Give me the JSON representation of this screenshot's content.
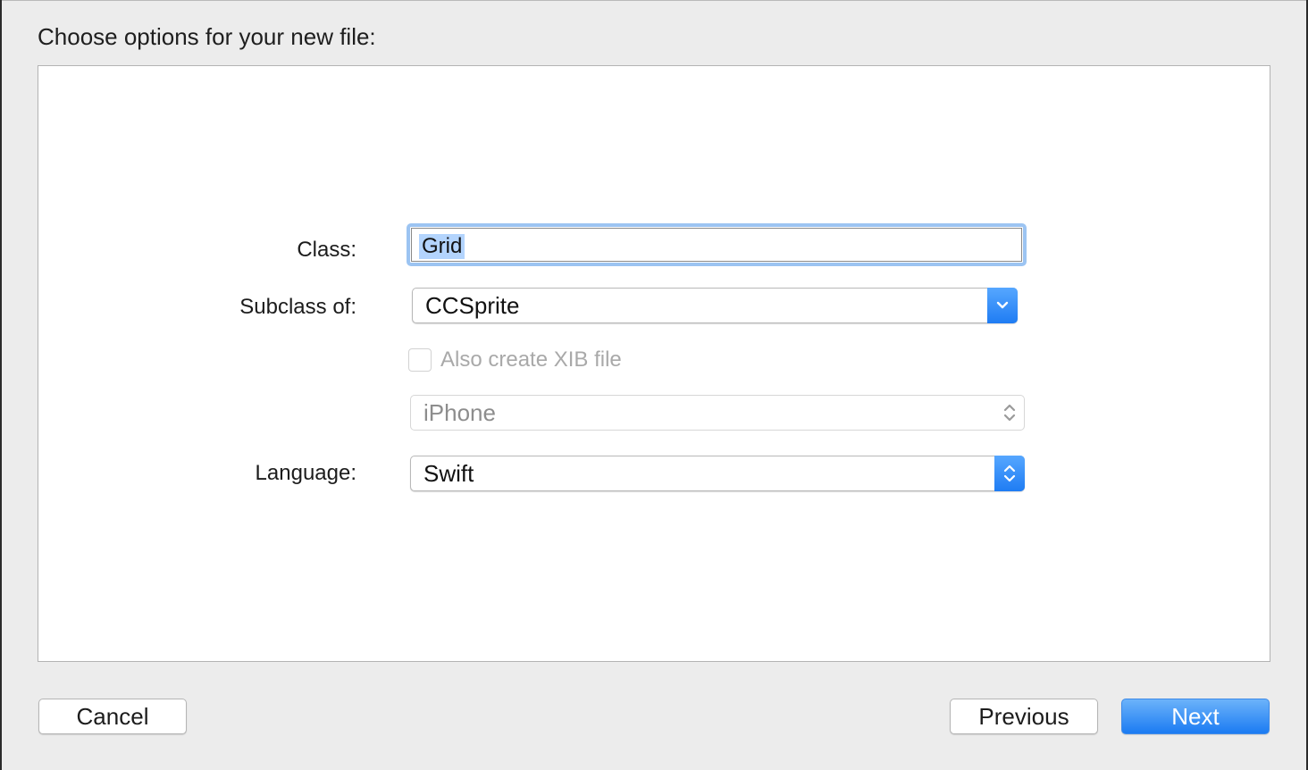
{
  "sheet": {
    "title": "Choose options for your new file:"
  },
  "form": {
    "class_label": "Class:",
    "class_value": "Grid",
    "subclass_label": "Subclass of:",
    "subclass_value": "CCSprite",
    "xib_checkbox_label": "Also create XIB file",
    "xib_checked": false,
    "device_value": "iPhone",
    "language_label": "Language:",
    "language_value": "Swift"
  },
  "buttons": {
    "cancel": "Cancel",
    "previous": "Previous",
    "next": "Next"
  },
  "colors": {
    "accent": "#1b7bf2",
    "focus_ring": "#9cc4f2",
    "selection": "#b3d4fd"
  },
  "icons": {
    "subclass_popup": "chevron-down-icon",
    "device_popup": "up-down-arrows-icon",
    "language_popup": "up-down-arrows-icon"
  }
}
